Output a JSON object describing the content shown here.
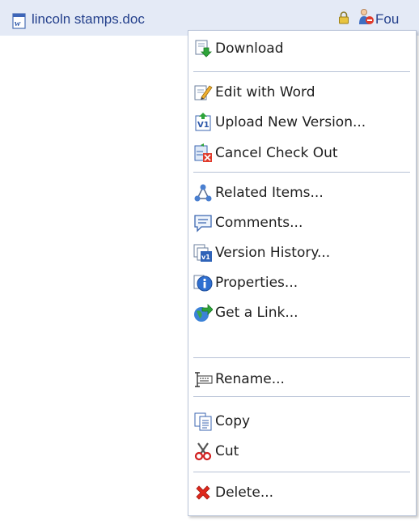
{
  "file": {
    "name": "lincoln stamps.doc",
    "user": "Fou",
    "icon": "word-document-icon"
  },
  "menu": {
    "items": [
      {
        "label": "Download",
        "icon": "download-icon"
      },
      {
        "label": "Edit with Word",
        "icon": "edit-icon"
      },
      {
        "label": "Upload New Version...",
        "icon": "upload-version-icon"
      },
      {
        "label": "Cancel Check Out",
        "icon": "cancel-checkout-icon"
      },
      {
        "label": "Related Items...",
        "icon": "related-items-icon"
      },
      {
        "label": "Comments...",
        "icon": "comments-icon"
      },
      {
        "label": "Version History...",
        "icon": "version-history-icon"
      },
      {
        "label": "Properties...",
        "icon": "properties-icon"
      },
      {
        "label": "Get a Link...",
        "icon": "get-link-icon"
      },
      {
        "label": "Rename...",
        "icon": "rename-icon"
      },
      {
        "label": "Copy",
        "icon": "copy-icon"
      },
      {
        "label": "Cut",
        "icon": "cut-icon"
      },
      {
        "label": "Delete...",
        "icon": "delete-icon"
      }
    ]
  },
  "colors": {
    "row_bg": "#e4eaf6",
    "link": "#24408c",
    "separator": "#b7c2d6"
  }
}
